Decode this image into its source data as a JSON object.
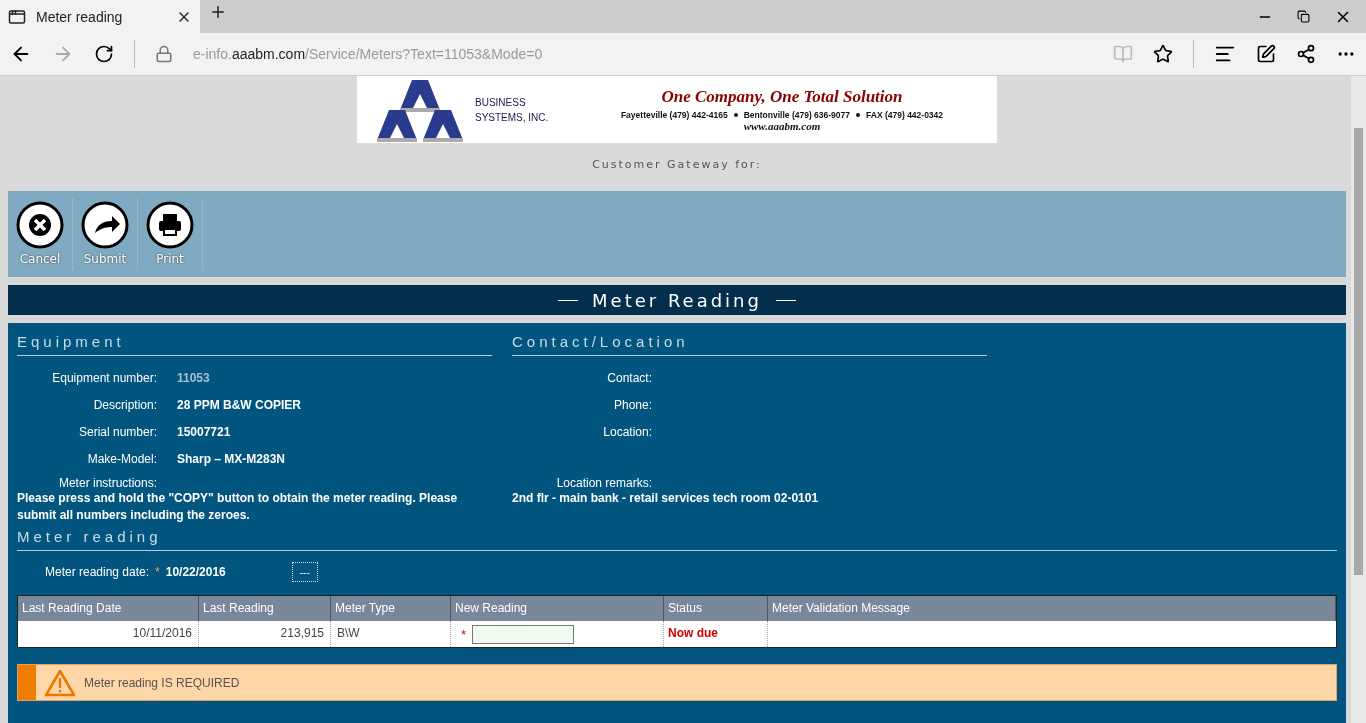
{
  "browser": {
    "tab": {
      "title": "Meter reading"
    },
    "url": {
      "prefix": "e-info.",
      "domain": "aaabm.com",
      "path": "/Service/Meters?Text=11053&Mode=0"
    }
  },
  "banner": {
    "company": [
      "BUSINESS",
      "SYSTEMS, INC."
    ],
    "slogan": "One Company, One Total Solution",
    "phones": [
      "Fayetteville (479) 442-4165",
      "Bentonville (479) 636-9077",
      "FAX (479) 442-0342"
    ],
    "website": "www.aaabm.com"
  },
  "gateway": "Customer Gateway for:",
  "toolbar": [
    {
      "label": "Cancel",
      "kind": "cancel"
    },
    {
      "label": "Submit",
      "kind": "submit"
    },
    {
      "label": "Print",
      "kind": "print"
    }
  ],
  "title": "Meter Reading",
  "equipment": {
    "heading": "Equipment",
    "fields": [
      {
        "label": "Equipment number:",
        "value": "11053",
        "kind": "link"
      },
      {
        "label": "Description:",
        "value": "28 PPM B&W COPIER",
        "kind": "text"
      },
      {
        "label": "Serial number:",
        "value": "15007721",
        "kind": "text"
      },
      {
        "label": "Make-Model:",
        "value": "Sharp – MX-M283N",
        "kind": "text"
      }
    ],
    "notes_label": "Meter instructions:",
    "notes": "Please press and hold the \"COPY\" button to obtain the meter reading. Please submit all numbers including the zeroes."
  },
  "contact": {
    "heading": "Contact/Location",
    "fields": [
      {
        "label": "Contact:"
      },
      {
        "label": "Phone:"
      },
      {
        "label": "Location:"
      }
    ],
    "notes_label": "Location remarks:",
    "notes": "2nd flr - main bank - retail services tech room 02-0101"
  },
  "meter_reading": {
    "heading": "Meter reading",
    "date_label": "Meter reading date:",
    "required_mark": "*",
    "date": "10/22/2016",
    "picker": "---"
  },
  "table": {
    "columns": [
      "Last Reading Date",
      "Last Reading",
      "Meter Type",
      "New Reading",
      "Status",
      "Meter Validation Message"
    ],
    "rows": [
      {
        "last_reading_date": "10/11/2016",
        "last_reading": "213,915",
        "meter_type": "B\\W",
        "required_mark": "*",
        "status": "Now due"
      }
    ]
  },
  "warning": "Meter reading IS REQUIRED"
}
